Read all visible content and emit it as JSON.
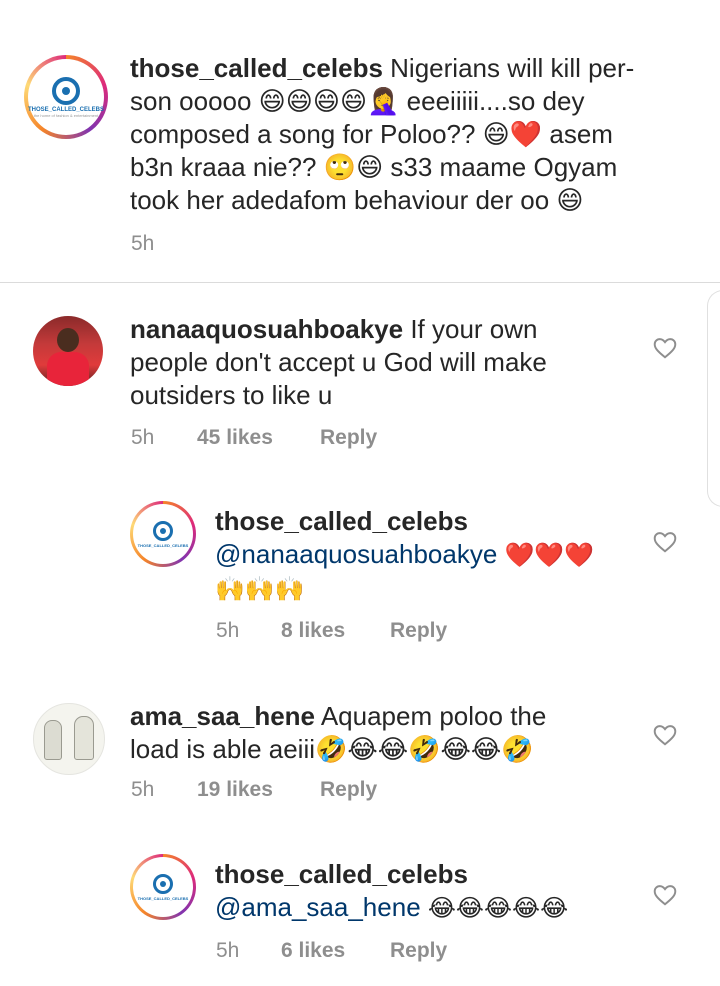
{
  "comments": [
    {
      "username": "those_called_celebs",
      "text": "Nigerians will kill per-son ooooo 😄😄😄😄🤦‍♀️ eeeiiiii....so dey composed a song for Poloo?? 😄❤️ asem b3n kraaa nie?? 🙄😄 s33 maame Ogyam took her adedafom behaviour der oo 😄",
      "lines": [
        "Nigerians will kill per-",
        "son ooooo 😄😄😄😄🤦‍♀️ eeeiiiii....so dey",
        "composed a song for Poloo?? 😄❤️ asem",
        "b3n kraaa nie?? 🙄😄 s33 maame Ogyam",
        "took her adedafom behaviour der oo 😄"
      ],
      "time": "5h",
      "logo_text": "THOSE_CALLED_CELEBS",
      "logo_sub": "the home of fashion & entertainment"
    },
    {
      "username": "nanaaquosuahboakye",
      "lines": [
        "If your own",
        "people don't accept u God will make",
        "outsiders to like u"
      ],
      "time": "5h",
      "likes": "45 likes",
      "reply": "Reply"
    },
    {
      "username": "those_called_celebs",
      "mention": "@nanaaquosuahboakye",
      "emojis_line1": "❤️❤️❤️",
      "emojis_line2": "🙌🙌🙌",
      "time": "5h",
      "likes": "8 likes",
      "reply": "Reply",
      "logo_text": "THOSE_CALLED_CELEBS"
    },
    {
      "username": "ama_saa_hene",
      "lines": [
        "Aquapem poloo the",
        "load is able aeiii🤣😂😂🤣😂😂🤣"
      ],
      "time": "5h",
      "likes": "19 likes",
      "reply": "Reply"
    },
    {
      "username": "those_called_celebs",
      "mention": "@ama_saa_hene",
      "emojis": "😂😂😂😂😂",
      "time": "5h",
      "likes": "6 likes",
      "reply": "Reply",
      "logo_text": "THOSE_CALLED_CELEBS"
    }
  ],
  "icons": {
    "like": "heart-outline-icon"
  },
  "colors": {
    "text": "#262626",
    "meta": "#8e8e8e",
    "mention": "#00376b",
    "logo": "#1a6fb0"
  }
}
